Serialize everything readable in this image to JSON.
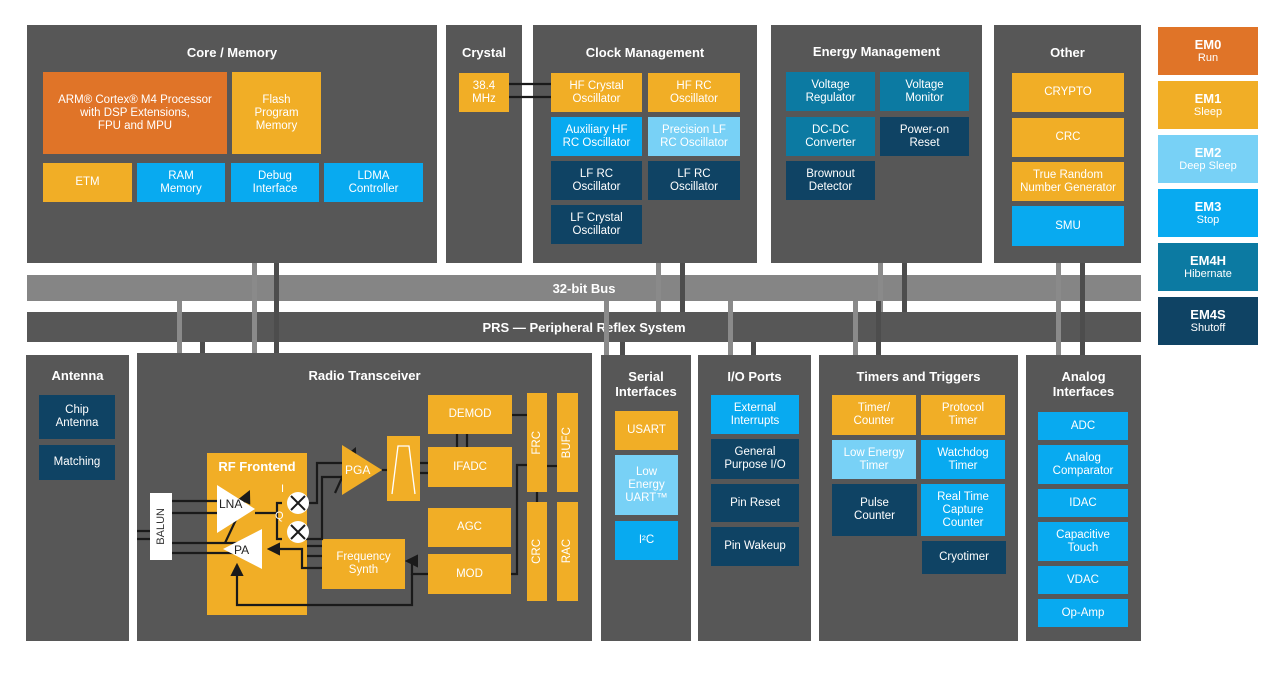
{
  "panels": {
    "core_memory": {
      "title": "Core / Memory",
      "blocks": {
        "processor": "ARM® Cortex® M4 Processor\nwith DSP Extensions,\nFPU and MPU",
        "flash": "Flash\nProgram\nMemory",
        "etm": "ETM",
        "ram": "RAM\nMemory",
        "debug": "Debug\nInterface",
        "ldma": "LDMA\nController"
      }
    },
    "crystal": {
      "title": "Crystal",
      "blocks": {
        "xtal": "38.4\nMHz"
      }
    },
    "clock_management": {
      "title": "Clock Management",
      "blocks": {
        "hfxo": "HF Crystal\nOscillator",
        "hfrco": "HF RC\nOscillator",
        "auxhfrco": "Auxiliary HF\nRC Oscillator",
        "plfrco": "Precision LF\nRC Oscillator",
        "lfrco1": "LF RC\nOscillator",
        "lfrco2": "LF RC\nOscillator",
        "lfxo": "LF Crystal\nOscillator"
      }
    },
    "energy_management": {
      "title": "Energy Management",
      "blocks": {
        "vreg": "Voltage\nRegulator",
        "vmon": "Voltage\nMonitor",
        "dcdc": "DC-DC\nConverter",
        "por": "Power-on\nReset",
        "bod": "Brownout\nDetector"
      }
    },
    "other": {
      "title": "Other",
      "blocks": {
        "crypto": "CRYPTO",
        "crc": "CRC",
        "trng": "True Random\nNumber Generator",
        "smu": "SMU"
      }
    },
    "antenna": {
      "title": "Antenna",
      "blocks": {
        "chip": "Chip\nAntenna",
        "matching": "Matching"
      }
    },
    "radio": {
      "title": "Radio Transceiver",
      "rf_frontend": "RF Frontend",
      "blocks": {
        "balun": "BALUN",
        "lna": "LNA",
        "pa": "PA",
        "i_label": "I",
        "q_label": "Q",
        "pga": "PGA",
        "demod": "DEMOD",
        "ifadc": "IFADC",
        "agc": "AGC",
        "mod": "MOD",
        "synth": "Frequency\nSynth",
        "frc": "FRC",
        "bufc": "BUFC",
        "crc": "CRC",
        "rac": "RAC"
      }
    },
    "serial": {
      "title": "Serial\nInterfaces",
      "blocks": {
        "usart": "USART",
        "leuart": "Low\nEnergy\nUART™",
        "i2c": "I²C"
      }
    },
    "io": {
      "title": "I/O Ports",
      "blocks": {
        "extint": "External\nInterrupts",
        "gpio": "General\nPurpose I/O",
        "pinreset": "Pin Reset",
        "pinwakeup": "Pin Wakeup"
      }
    },
    "timers": {
      "title": "Timers and Triggers",
      "blocks": {
        "timer": "Timer/\nCounter",
        "protimer": "Protocol\nTimer",
        "letimer": "Low Energy\nTimer",
        "wdog": "Watchdog\nTimer",
        "pcnt": "Pulse\nCounter",
        "rtcc": "Real Time\nCapture\nCounter",
        "cryotimer": "Cryotimer"
      }
    },
    "analog": {
      "title": "Analog\nInterfaces",
      "blocks": {
        "adc": "ADC",
        "acmp": "Analog\nComparator",
        "idac": "IDAC",
        "csen": "Capacitive\nTouch",
        "vdac": "VDAC",
        "opamp": "Op-Amp"
      }
    }
  },
  "buses": {
    "bus32": "32-bit Bus",
    "prs": "PRS — Peripheral Reflex System"
  },
  "legend": [
    {
      "em": "EM0",
      "mode": "Run",
      "color": "#e07428"
    },
    {
      "em": "EM1",
      "mode": "Sleep",
      "color": "#f1ae26"
    },
    {
      "em": "EM2",
      "mode": "Deep Sleep",
      "color": "#78d1f6"
    },
    {
      "em": "EM3",
      "mode": "Stop",
      "color": "#08aaf0"
    },
    {
      "em": "EM4H",
      "mode": "Hibernate",
      "color": "#0c7aa2"
    },
    {
      "em": "EM4S",
      "mode": "Shutoff",
      "color": "#0f4364"
    }
  ]
}
